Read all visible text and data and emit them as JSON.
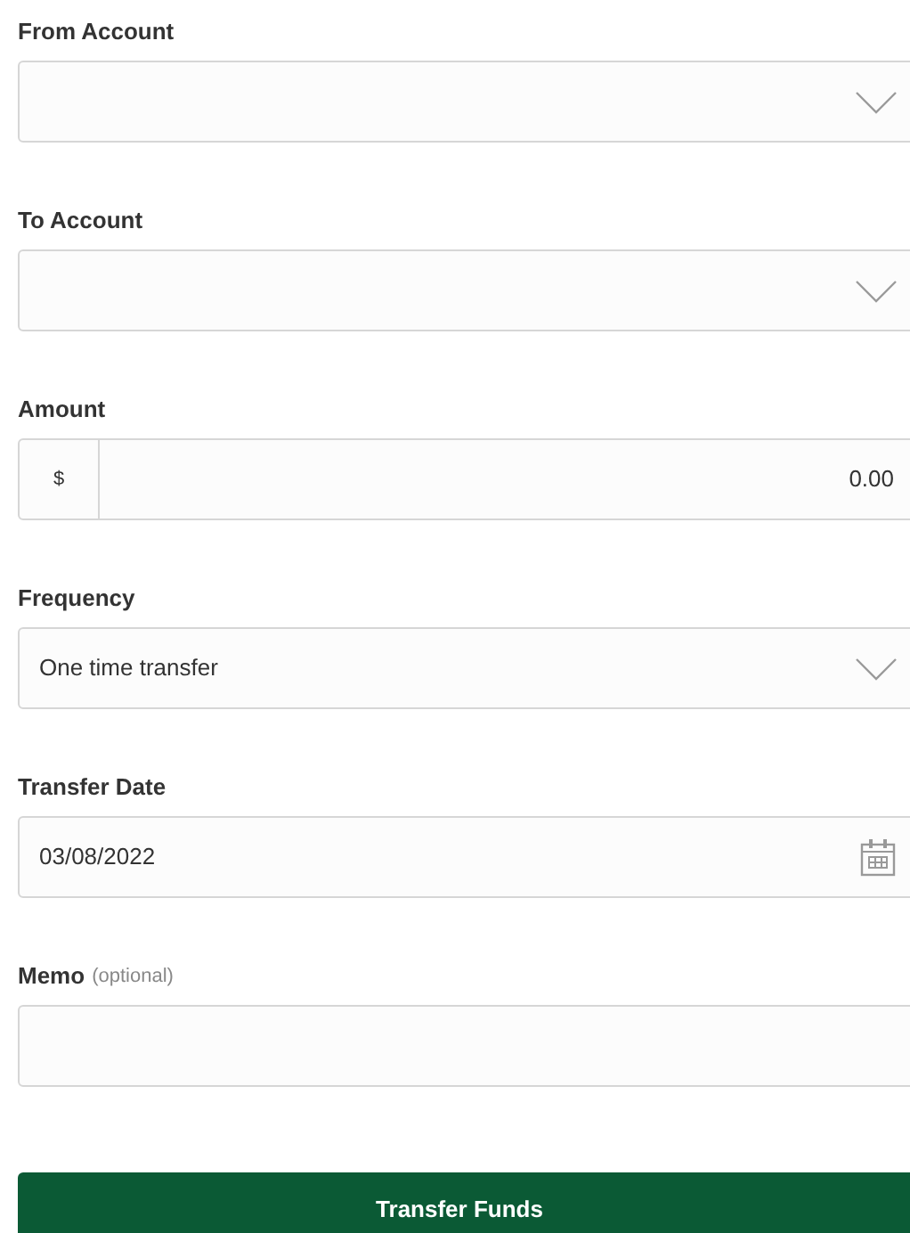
{
  "fields": [
    {
      "kind": "select",
      "label": "From Account"
    },
    {
      "kind": "select",
      "label": "To Account"
    },
    {
      "kind": "prefixed",
      "label": "Amount",
      "prefix": "$",
      "value": "0.00"
    },
    {
      "kind": "select",
      "label": "Frequency",
      "value": "One time transfer"
    },
    {
      "kind": "date",
      "label": "Transfer Date",
      "value": "03/08/2022"
    },
    {
      "kind": "text",
      "label": "Memo",
      "hint": "(optional)"
    }
  ],
  "submit": {
    "label": "Transfer Funds"
  }
}
